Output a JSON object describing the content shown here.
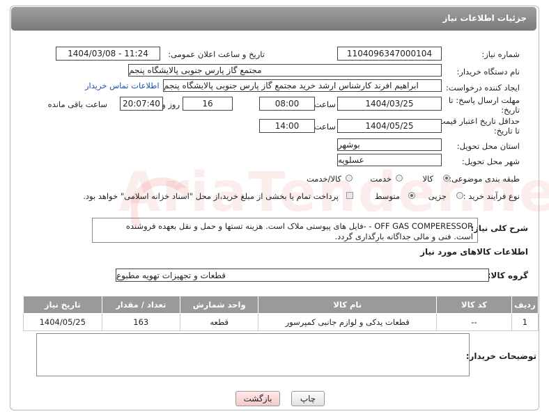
{
  "header": {
    "title": "جزئیات اطلاعات نیاز"
  },
  "fields": {
    "need_number_label": "شماره نیاز:",
    "need_number": "1104096347000104",
    "announce_label": "تاریخ و ساعت اعلان عمومی:",
    "announce_value": "1404/03/08 - 11:24",
    "buyer_org_label": "نام دستگاه خریدار:",
    "buyer_org": "مجتمع گاز پارس جنوبی  پالایشگاه پنجم",
    "creator_label": "ایجاد کننده درخواست:",
    "creator": "ابراهیم افرند کارشناس ارشد خرید مجتمع گاز پارس جنوبی  پالایشگاه پنجم",
    "contact_link": "اطلاعات تماس خریدار",
    "reply_deadline_label_1": "مهلت ارسال پاسخ: تا",
    "reply_deadline_label_2": "تاریخ:",
    "reply_date": "1404/03/25",
    "time_label": "ساعت",
    "reply_time": "08:00",
    "days_value": "16",
    "days_label": "روز و",
    "remaining_time": "20:07:40",
    "remaining_label": "ساعت باقی مانده",
    "price_validity_label_1": "حداقل تاریخ اعتبار قیمت:",
    "price_validity_label_2": "تا تاریخ:",
    "price_date": "1404/05/25",
    "price_time": "14:00",
    "province_label": "استان محل تحویل:",
    "province": "بوشهر",
    "city_label": "شهر محل تحویل:",
    "city": "عسلویه",
    "category_label": "طبقه بندی موضوعی:",
    "category_options": [
      "کالا",
      "خدمت",
      "کالا/خدمت"
    ],
    "process_label": "نوع فرآیند خرید :",
    "process_options": [
      "جزیی",
      "متوسط"
    ],
    "payment_note": "پرداخت تمام یا بخشی از مبلغ خرید،از محل \"اسناد خزانه اسلامی\" خواهد بود.",
    "description_label": "شرح کلی نیاز:",
    "description_line1": "OFF GAS COMPERESSOR - -فایل های پیوستی ملاک است. هزینه تستها و حمل و نقل بعهده فروشنده",
    "description_line2": "است. فنی و مالی جداگانه بارگذاری گردد."
  },
  "goods": {
    "section_title": "اطلاعات کالاهای مورد نیاز",
    "group_label": "گروه کالا:",
    "group_value": "قطعات و تجهیزات تهویه مطبوع",
    "columns": [
      "ردیف",
      "کد کالا",
      "نام کالا",
      "واحد شمارش",
      "تعداد / مقدار",
      "تاریخ نیاز"
    ],
    "rows": [
      {
        "index": "1",
        "code": "--",
        "name": "قطعات یدکی و لوازم جانبی کمپرسور",
        "unit": "قطعه",
        "qty": "163",
        "date": "1404/05/25"
      }
    ]
  },
  "buyer_notes_label": "توضیحات خریدار:",
  "buttons": {
    "print": "چاپ",
    "back": "بازگشت"
  },
  "watermark": "AriaTender.neT"
}
